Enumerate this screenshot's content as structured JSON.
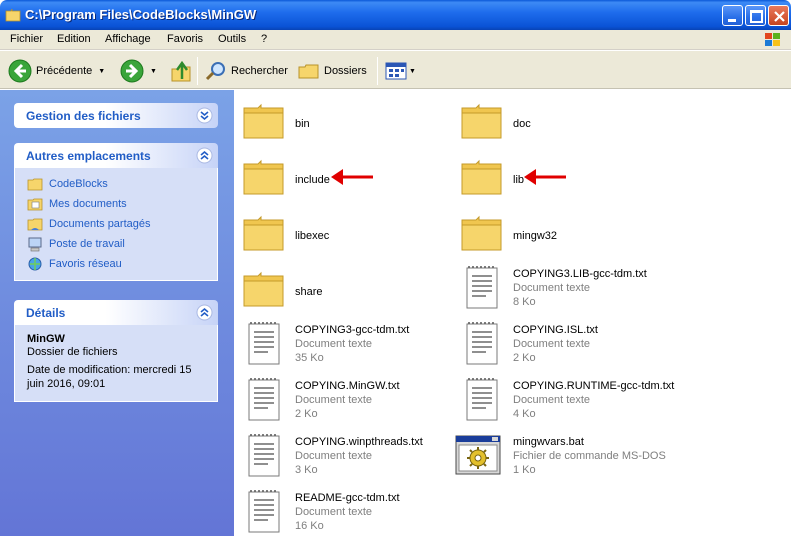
{
  "window": {
    "title": "C:\\Program Files\\CodeBlocks\\MinGW"
  },
  "menu": [
    "Fichier",
    "Edition",
    "Affichage",
    "Favoris",
    "Outils",
    "?"
  ],
  "toolbar": {
    "back_label": "Précédente",
    "search_label": "Rechercher",
    "folders_label": "Dossiers"
  },
  "sidebar": {
    "file_tasks_title": "Gestion des fichiers",
    "other_places_title": "Autres emplacements",
    "other_places": [
      {
        "label": "CodeBlocks",
        "icon": "folder-icon"
      },
      {
        "label": "Mes documents",
        "icon": "my-documents-icon"
      },
      {
        "label": "Documents partagés",
        "icon": "shared-documents-icon"
      },
      {
        "label": "Poste de travail",
        "icon": "my-computer-icon"
      },
      {
        "label": "Favoris réseau",
        "icon": "network-places-icon"
      }
    ],
    "details_title": "Détails",
    "details": {
      "name": "MinGW",
      "type": "Dossier de fichiers",
      "modified": "Date de modification: mercredi 15 juin 2016, 09:01"
    }
  },
  "files": [
    {
      "name": "bin",
      "kind": "folder"
    },
    {
      "name": "doc",
      "kind": "folder"
    },
    {
      "name": "include",
      "kind": "folder",
      "highlighted": true
    },
    {
      "name": "lib",
      "kind": "folder",
      "highlighted": true
    },
    {
      "name": "libexec",
      "kind": "folder"
    },
    {
      "name": "mingw32",
      "kind": "folder"
    },
    {
      "name": "share",
      "kind": "folder"
    },
    {
      "name": "COPYING3.LIB-gcc-tdm.txt",
      "kind": "text",
      "type": "Document texte",
      "size": "8 Ko"
    },
    {
      "name": "COPYING3-gcc-tdm.txt",
      "kind": "text",
      "type": "Document texte",
      "size": "35 Ko"
    },
    {
      "name": "COPYING.ISL.txt",
      "kind": "text",
      "type": "Document texte",
      "size": "2 Ko"
    },
    {
      "name": "COPYING.MinGW.txt",
      "kind": "text",
      "type": "Document texte",
      "size": "2 Ko"
    },
    {
      "name": "COPYING.RUNTIME-gcc-tdm.txt",
      "kind": "text",
      "type": "Document texte",
      "size": "4 Ko"
    },
    {
      "name": "COPYING.winpthreads.txt",
      "kind": "text",
      "type": "Document texte",
      "size": "3 Ko"
    },
    {
      "name": "mingwvars.bat",
      "kind": "batch",
      "type": "Fichier de commande MS-DOS",
      "size": "1 Ko"
    },
    {
      "name": "README-gcc-tdm.txt",
      "kind": "text",
      "type": "Document texte",
      "size": "16 Ko"
    }
  ],
  "colors": {
    "accent_arrow": "#e00000",
    "panel_link": "#215dc6",
    "folder": "#f6d56b"
  }
}
